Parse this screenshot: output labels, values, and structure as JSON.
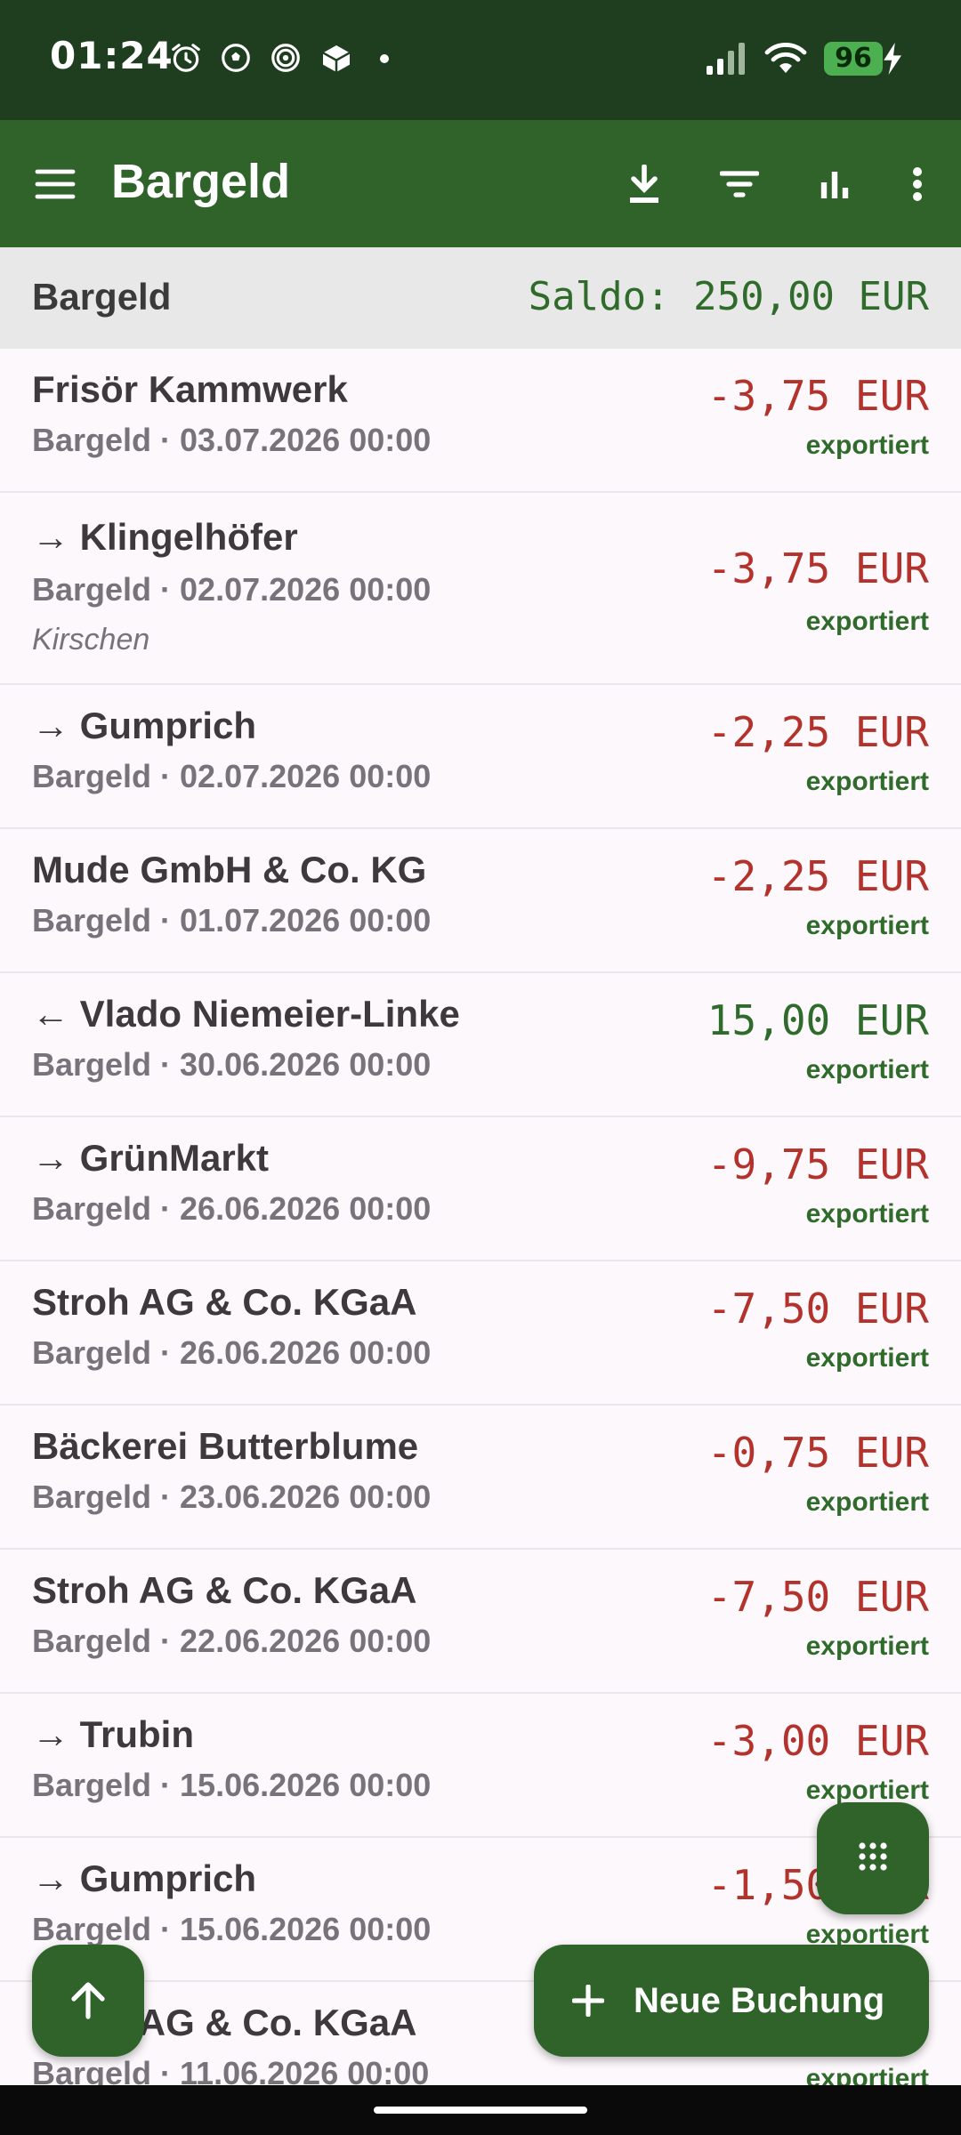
{
  "status_bar": {
    "time": "01:24",
    "battery": "96",
    "icons": [
      "alarm-icon",
      "soccer-ball-icon",
      "spiral-icon",
      "cube-icon",
      "dot-icon",
      "signal-icon",
      "wifi-icon",
      "battery-icon",
      "charging-bolt-icon"
    ]
  },
  "app_bar": {
    "title": "Bargeld",
    "actions": [
      "download-icon",
      "filter-icon",
      "chart-icon",
      "more-vert-icon"
    ]
  },
  "balance": {
    "account": "Bargeld",
    "saldo": "Saldo: 250,00 EUR"
  },
  "transactions": [
    {
      "payee": "Frisör Kammwerk",
      "meta": "Bargeld · 03.07.2026 00:00",
      "note": "",
      "amount": "-3,75 EUR",
      "status": "exportiert",
      "negative": true
    },
    {
      "payee": "→ Klingelhöfer",
      "meta": "Bargeld · 02.07.2026 00:00",
      "note": "Kirschen",
      "amount": "-3,75 EUR",
      "status": "exportiert",
      "negative": true
    },
    {
      "payee": "→ Gumprich",
      "meta": "Bargeld · 02.07.2026 00:00",
      "note": "",
      "amount": "-2,25 EUR",
      "status": "exportiert",
      "negative": true
    },
    {
      "payee": "Mude GmbH & Co. KG",
      "meta": "Bargeld · 01.07.2026 00:00",
      "note": "",
      "amount": "-2,25 EUR",
      "status": "exportiert",
      "negative": true
    },
    {
      "payee": "← Vlado Niemeier-Linke",
      "meta": "Bargeld · 30.06.2026 00:00",
      "note": "",
      "amount": "15,00 EUR",
      "status": "exportiert",
      "negative": false
    },
    {
      "payee": "→ GrünMarkt",
      "meta": "Bargeld · 26.06.2026 00:00",
      "note": "",
      "amount": "-9,75 EUR",
      "status": "exportiert",
      "negative": true
    },
    {
      "payee": "Stroh AG & Co. KGaA",
      "meta": "Bargeld · 26.06.2026 00:00",
      "note": "",
      "amount": "-7,50 EUR",
      "status": "exportiert",
      "negative": true
    },
    {
      "payee": "Bäckerei Butterblume",
      "meta": "Bargeld · 23.06.2026 00:00",
      "note": "",
      "amount": "-0,75 EUR",
      "status": "exportiert",
      "negative": true
    },
    {
      "payee": "Stroh AG & Co. KGaA",
      "meta": "Bargeld · 22.06.2026 00:00",
      "note": "",
      "amount": "-7,50 EUR",
      "status": "exportiert",
      "negative": true
    },
    {
      "payee": "→ Trubin",
      "meta": "Bargeld · 15.06.2026 00:00",
      "note": "",
      "amount": "-3,00 EUR",
      "status": "exportiert",
      "negative": true
    },
    {
      "payee": "→ Gumprich",
      "meta": "Bargeld · 15.06.2026 00:00",
      "note": "",
      "amount": "-1,50 EUR",
      "status": "exportiert",
      "negative": true
    },
    {
      "payee": "Stroh AG & Co. KGaA",
      "meta": "Bargeld · 11.06.2026 00:00",
      "note": "",
      "amount": "",
      "status": "exportiert",
      "negative": true
    }
  ],
  "fabs": {
    "new_booking": "Neue Buchung",
    "keypad_icon": "dialpad-icon",
    "up_icon": "arrow-up-icon"
  },
  "colors": {
    "status_bar": "#1e3e1f",
    "app_bar": "#2f6329",
    "negative": "#b3322b",
    "positive": "#2f6b2a"
  }
}
